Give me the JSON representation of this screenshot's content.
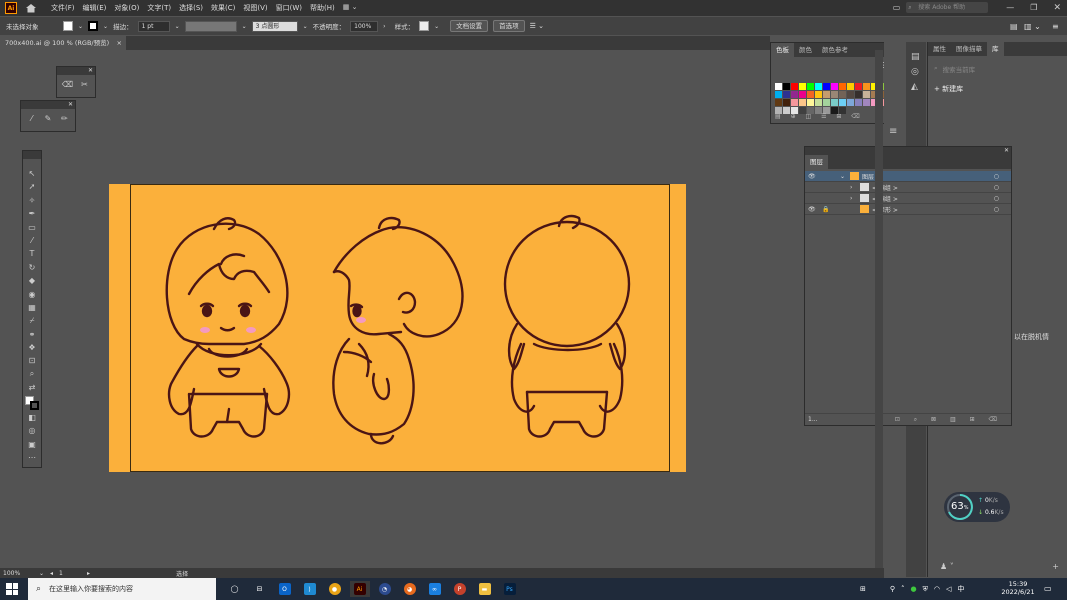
{
  "menubar": {
    "logo": "Ai",
    "menus": [
      "文件(F)",
      "编辑(E)",
      "对象(O)",
      "文字(T)",
      "选择(S)",
      "效果(C)",
      "视图(V)",
      "窗口(W)",
      "帮助(H)"
    ],
    "search_placeholder": "搜索 Adobe 帮助"
  },
  "controlbar": {
    "selection": "未选择对象",
    "stroke_label": "描边：",
    "stroke_value": "1 pt",
    "brush_value": "3 点圆形",
    "opacity_label": "不透明度：",
    "opacity_value": "100%",
    "style_label": "样式：",
    "doc_setup": "文档设置",
    "prefs": "首选项"
  },
  "doc": {
    "tab": "700x400.ai @ 100 % (RGB/预览)",
    "close": "×"
  },
  "swatches": {
    "tabs": [
      "色板",
      "颜色",
      "颜色参考"
    ],
    "colors": [
      "#ffffff",
      "#000000",
      "#ff0000",
      "#ffff00",
      "#00ff00",
      "#00ffff",
      "#0000ff",
      "#ff00ff",
      "#ff6600",
      "#ffcc00",
      "#ed1c24",
      "#f7941d",
      "#fff200",
      "#8dc63f",
      "#00a651",
      "#00aeef",
      "#2e3192",
      "#92278f",
      "#ec008c",
      "#f26522",
      "#ffc20e",
      "#c69c6d",
      "#998675",
      "#736357",
      "#534741",
      "#362f2d",
      "#c7b299",
      "#a67c52",
      "#8c6239",
      "#754c24",
      "#603913",
      "#42210b",
      "#f5989d",
      "#fdc689",
      "#fff799",
      "#c4df9b",
      "#a3d39c",
      "#7accc8",
      "#6dcff6",
      "#7da7d9",
      "#8781bd",
      "#a186be",
      "#f49ac1",
      "#f6989d",
      "#898989",
      "#b3b3b3",
      "#cccccc",
      "#e6e6e6",
      "#404040",
      "#666666",
      "#808080",
      "#999999",
      "#1a1a1a",
      "#333333"
    ]
  },
  "right_panel": {
    "tabs": [
      "属性",
      "图像描摹",
      "库"
    ],
    "search_placeholder": "搜索当前库",
    "new_library": "新建库",
    "partial_text": "以在脱机情"
  },
  "layers": {
    "title": "图层",
    "rows": [
      {
        "name": "图层 1",
        "selected": true
      },
      {
        "name": "< 编组 >",
        "selected": false
      },
      {
        "name": "< 编组 >",
        "selected": false
      },
      {
        "name": "< 矩形 >",
        "selected": false
      }
    ],
    "count": "1..."
  },
  "status": {
    "zoom": "100%",
    "page": "1",
    "tool": "选择"
  },
  "netmeter": {
    "percent": "63",
    "unit": "%",
    "up": "0",
    "up_unit": "K/s",
    "down": "0.6",
    "down_unit": "K/s"
  },
  "taskbar": {
    "search_text": "在这里输入你要搜索的内容",
    "time": "15:39",
    "date": "2022/6/21"
  },
  "colors": {
    "artboard": "#fbb03b",
    "stroke": "#4a1515",
    "blush": "#f49ac1"
  }
}
